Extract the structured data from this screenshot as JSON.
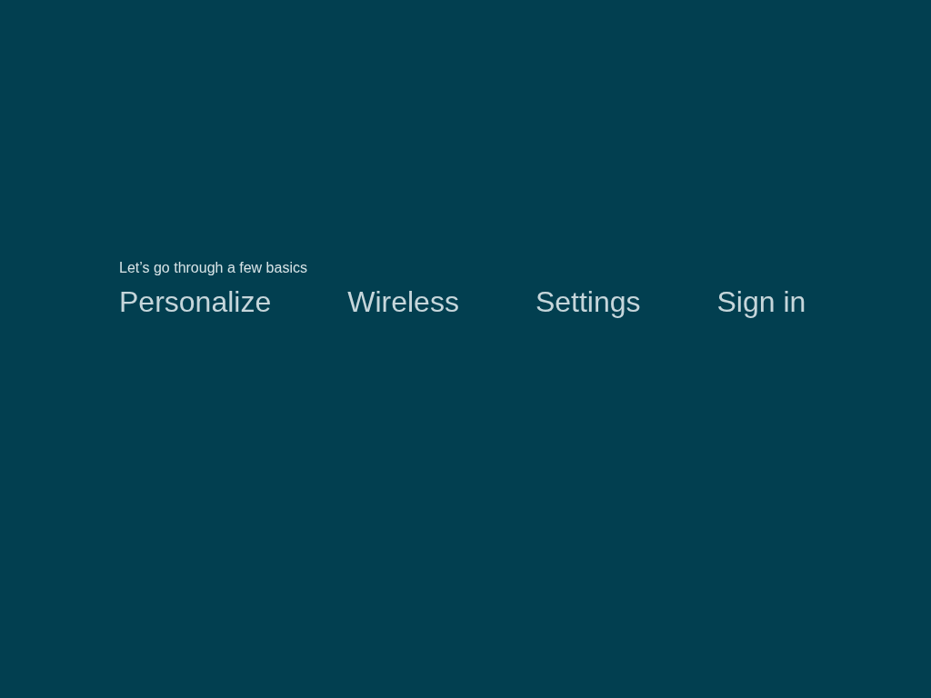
{
  "subtitle": "Let’s go through a few basics",
  "steps": [
    "Personalize",
    "Wireless",
    "Settings",
    "Sign in"
  ]
}
